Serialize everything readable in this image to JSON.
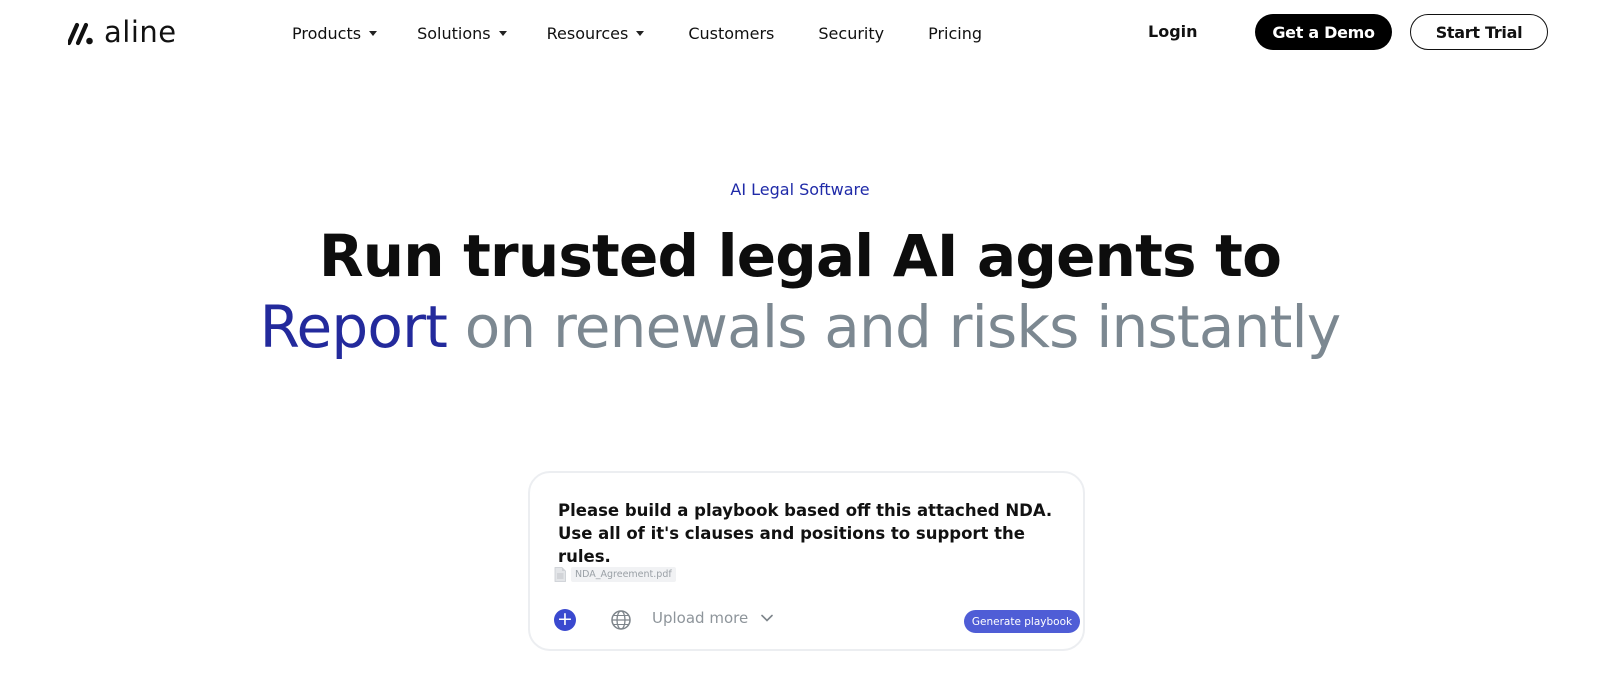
{
  "brand": {
    "name": "aline"
  },
  "nav": {
    "dropdowns": [
      {
        "label": "Products"
      },
      {
        "label": "Solutions"
      },
      {
        "label": "Resources"
      }
    ],
    "links": [
      {
        "label": "Customers"
      },
      {
        "label": "Security"
      },
      {
        "label": "Pricing"
      }
    ],
    "login": "Login",
    "demo": "Get a Demo",
    "trial": "Start Trial"
  },
  "hero": {
    "eyebrow": "AI Legal Software",
    "headline": "Run trusted legal AI agents to",
    "sub_accent": "Report",
    "sub_rest": "on renewals and risks instantly",
    "colors": {
      "accent": "#232a9c",
      "muted": "#7c8891",
      "eyebrow": "#1f2aa8"
    }
  },
  "prompt_card": {
    "text": "Please build a playbook based off this attached NDA. Use all of it's clauses and positions to support the rules.",
    "attachment": "NDA_Agreement.pdf",
    "icons": [
      "plus-icon",
      "globe-icon",
      "chevron-down-icon",
      "file-icon"
    ],
    "upload_label": "Upload more",
    "generate_label": "Generate playbook",
    "colors": {
      "button": "#4f5dd6",
      "plus": "#3a49cf"
    }
  }
}
